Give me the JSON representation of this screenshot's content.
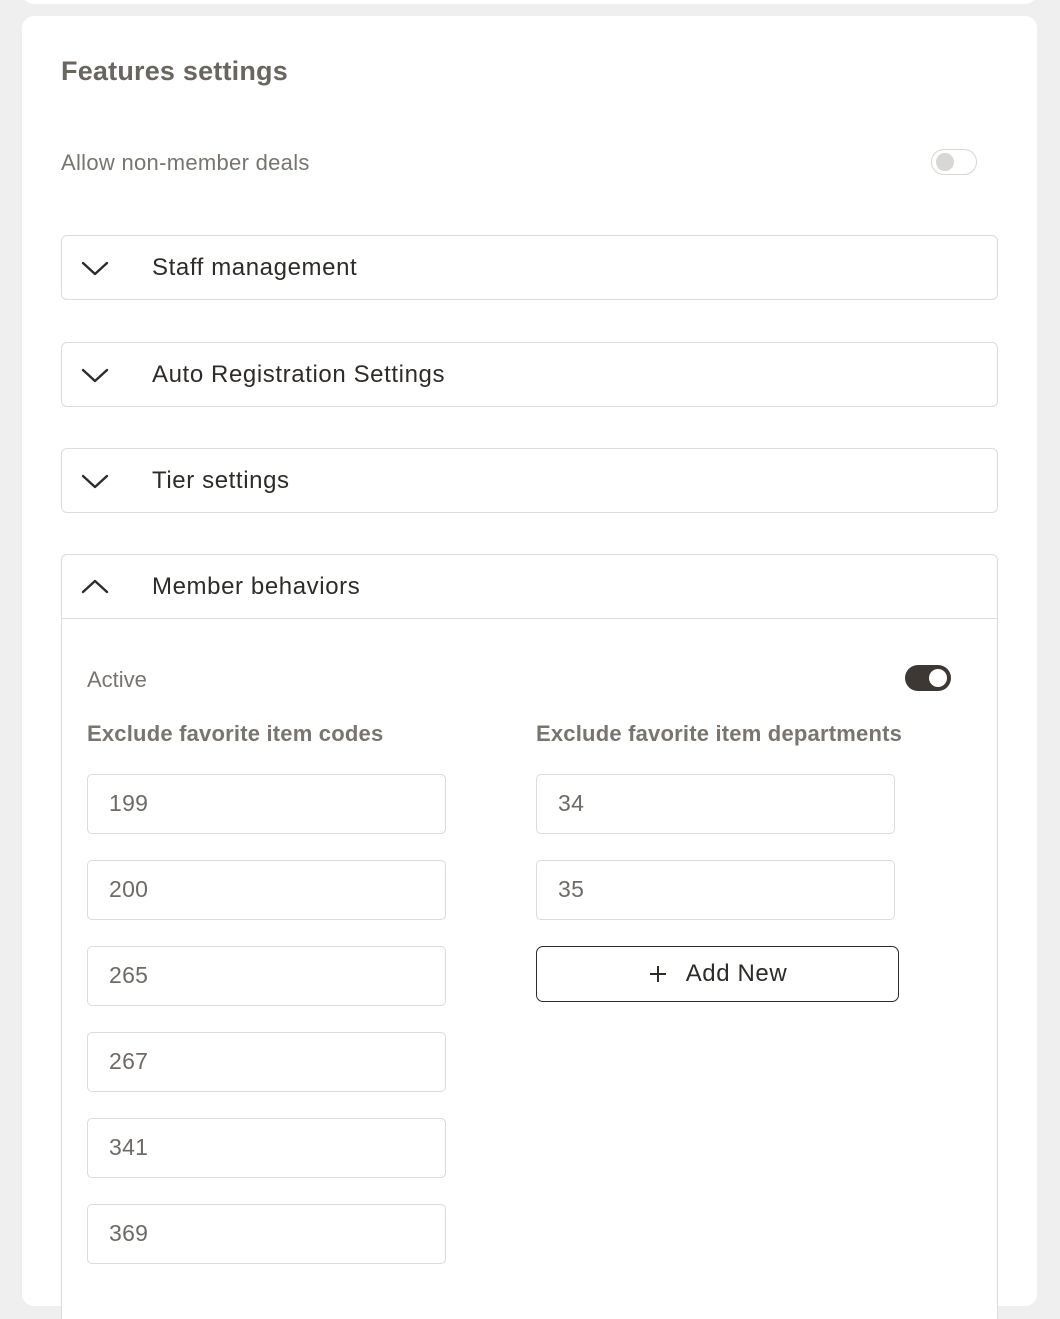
{
  "card": {
    "title": "Features settings",
    "allow_non_member_deals": {
      "label": "Allow non-member deals",
      "enabled": false
    }
  },
  "sections": [
    {
      "title": "Staff management",
      "expanded": false,
      "icon": "chevron-down-icon"
    },
    {
      "title": "Auto Registration Settings",
      "expanded": false,
      "icon": "chevron-down-icon"
    },
    {
      "title": "Tier settings",
      "expanded": false,
      "icon": "chevron-down-icon"
    },
    {
      "title": "Member behaviors",
      "expanded": true,
      "icon": "chevron-up-icon"
    }
  ],
  "member_behaviors": {
    "active_label": "Active",
    "active": true,
    "item_codes_header": "Exclude favorite item codes",
    "item_codes": [
      "199",
      "200",
      "265",
      "267",
      "341",
      "369"
    ],
    "departments_header": "Exclude favorite item departments",
    "departments": [
      "34",
      "35"
    ],
    "add_new_label": "Add New",
    "add_new_icon": "plus-icon"
  },
  "colors": {
    "toggle_on": "#3e3835",
    "border": "#dedbd8",
    "muted_text": "#7a746f"
  }
}
